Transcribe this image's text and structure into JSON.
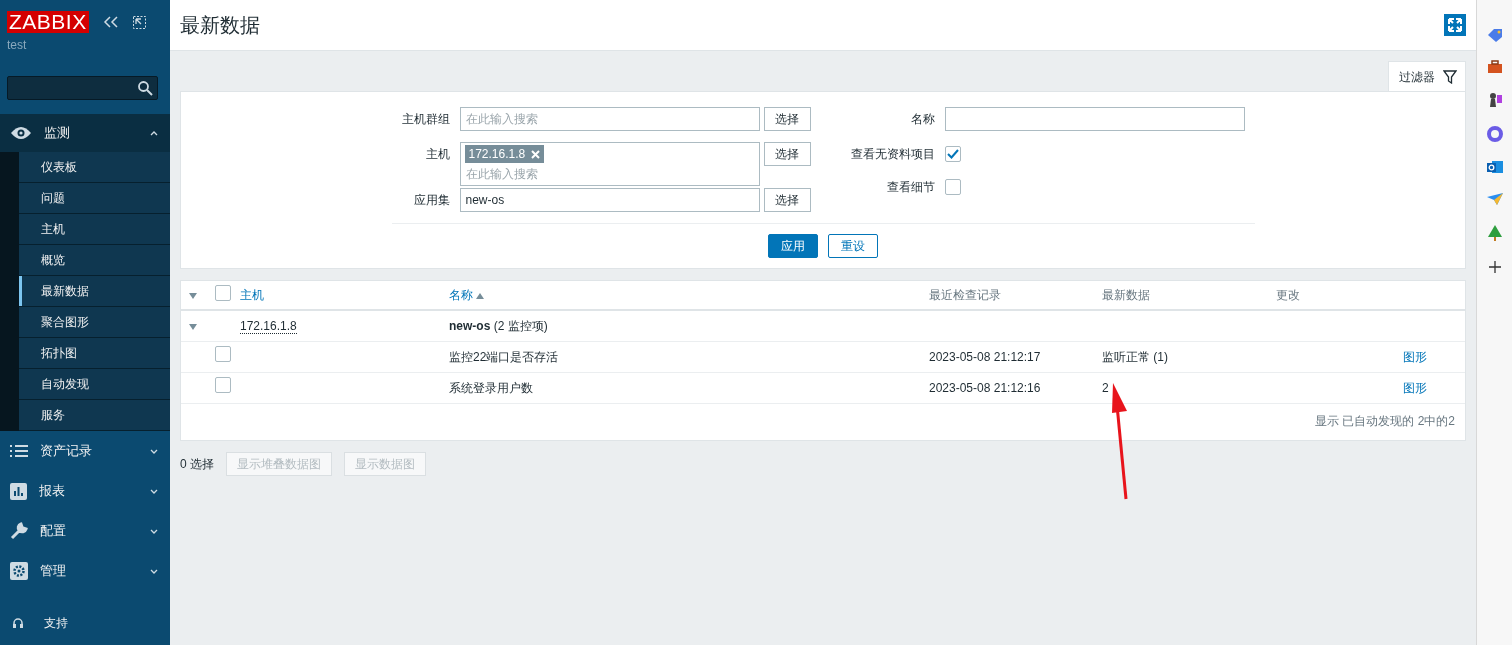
{
  "sidebar": {
    "logo": "ZABBIX",
    "server": "test",
    "menu": [
      {
        "label": "监测",
        "expanded": true,
        "children": [
          {
            "label": "仪表板",
            "selected": false
          },
          {
            "label": "问题",
            "selected": false
          },
          {
            "label": "主机",
            "selected": false
          },
          {
            "label": "概览",
            "selected": false
          },
          {
            "label": "最新数据",
            "selected": true
          },
          {
            "label": "聚合图形",
            "selected": false
          },
          {
            "label": "拓扑图",
            "selected": false
          },
          {
            "label": "自动发现",
            "selected": false
          },
          {
            "label": "服务",
            "selected": false
          }
        ]
      },
      {
        "label": "资产记录",
        "expanded": false
      },
      {
        "label": "报表",
        "expanded": false
      },
      {
        "label": "配置",
        "expanded": false
      },
      {
        "label": "管理",
        "expanded": false
      }
    ],
    "support": "支持"
  },
  "page": {
    "title": "最新数据"
  },
  "filter": {
    "tab": "过滤器",
    "host_group": {
      "label": "主机群组",
      "placeholder": "在此输入搜索",
      "button": "选择"
    },
    "host": {
      "label": "主机",
      "tags": [
        "172.16.1.8"
      ],
      "placeholder": "在此输入搜索",
      "button": "选择"
    },
    "application": {
      "label": "应用集",
      "value": "new-os",
      "button": "选择"
    },
    "name": {
      "label": "名称"
    },
    "show_without_data": {
      "label": "查看无资料项目",
      "checked": true
    },
    "show_details": {
      "label": "查看细节",
      "checked": false
    },
    "buttons": [
      "应用",
      "重设"
    ]
  },
  "table": {
    "columns": [
      {
        "label": "主机",
        "link": true
      },
      {
        "label": "名称",
        "link": true,
        "sorted_ascending": true
      },
      {
        "label": "最近检查记录",
        "link": false
      },
      {
        "label": "最新数据",
        "link": false
      },
      {
        "label": "更改",
        "link": false
      }
    ],
    "all_checked": false,
    "group": {
      "host": "172.16.1.8",
      "application": "new-os",
      "count": "(2 监控项)",
      "expanded": true
    },
    "rows": [
      {
        "checked": false,
        "name": "监控22端口是否存活",
        "last_check": "2023-05-08 21:12:17",
        "last_value": "监听正常 (1)",
        "link": "图形"
      },
      {
        "checked": false,
        "name": "系统登录用户数",
        "last_check": "2023-05-08 21:12:16",
        "last_value": "2",
        "link": "图形"
      }
    ],
    "summary": "显示 已自动发现的 2中的2"
  },
  "actions": {
    "selected": "0 选择",
    "buttons": [
      {
        "label": "显示堆叠数据图",
        "disabled": true
      },
      {
        "label": "显示数据图",
        "disabled": true
      }
    ]
  }
}
